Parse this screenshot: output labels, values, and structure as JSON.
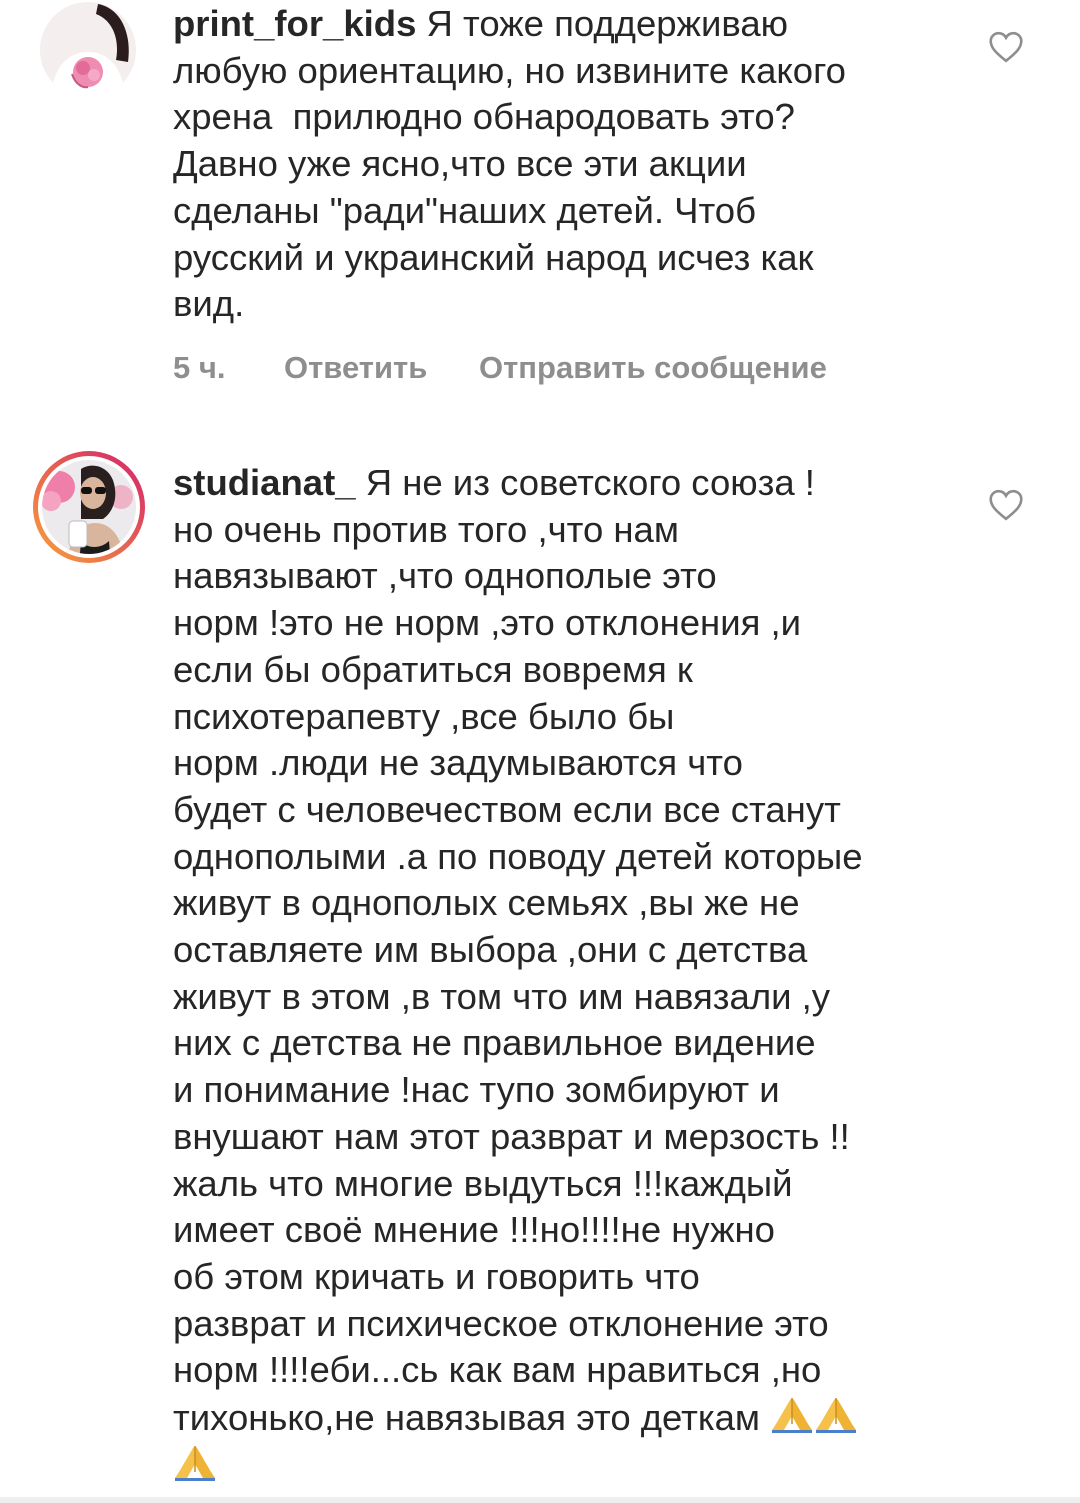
{
  "comments": [
    {
      "username": "print_for_kids",
      "first_line_text": "Я тоже поддерживаю",
      "lines": [
        "любую ориентацию, но извините какого",
        "хрена  прилюдно обнародовать это?",
        "Давно уже ясно,что все эти акции",
        "сделаны \"ради\"наших детей. Чтоб",
        "русский и украинский народ исчез как",
        "вид."
      ],
      "time": "5 ч.",
      "reply_label": "Ответить",
      "send_label": "Отправить сообщение"
    },
    {
      "username": "studianat_",
      "first_line_text": "Я не из советского союза !",
      "lines": [
        "но очень против того ,что нам",
        "навязывают ,что однополые это",
        "норм !это не норм ,это отклонения ,и",
        "если бы обратиться вовремя к",
        "психотерапевту ,все было бы",
        "норм .люди не задумываются что",
        "будет с человечеством если все станут",
        "однополыми .а по поводу детей которые",
        "живут в однополых семьях ,вы же не",
        "оставляете им выбора ,они с детства",
        "живут в этом ,в том что им навязали ,у",
        "них с детства не правильное видение",
        "и понимание !нас тупо зомбируют и",
        "внушают нам этот разврат и мерзость !!",
        "жаль что многие выдуться !!!каждый",
        "имеет своё мнение !!!но!!!!не нужно",
        "об этом кричать и говорить что",
        "разврат и психическое отклонение это",
        "норм !!!!еби...сь как вам нравиться ,но"
      ],
      "last_line_text": "тихонько,не навязывая это деткам",
      "emoji": "folded-hands-icon"
    }
  ],
  "colors": {
    "text": "#262626",
    "meta": "#8e8e8e",
    "heart": "#8e8e8e",
    "story_ring_start": "#f9a23a",
    "story_ring_end": "#d3216b"
  }
}
